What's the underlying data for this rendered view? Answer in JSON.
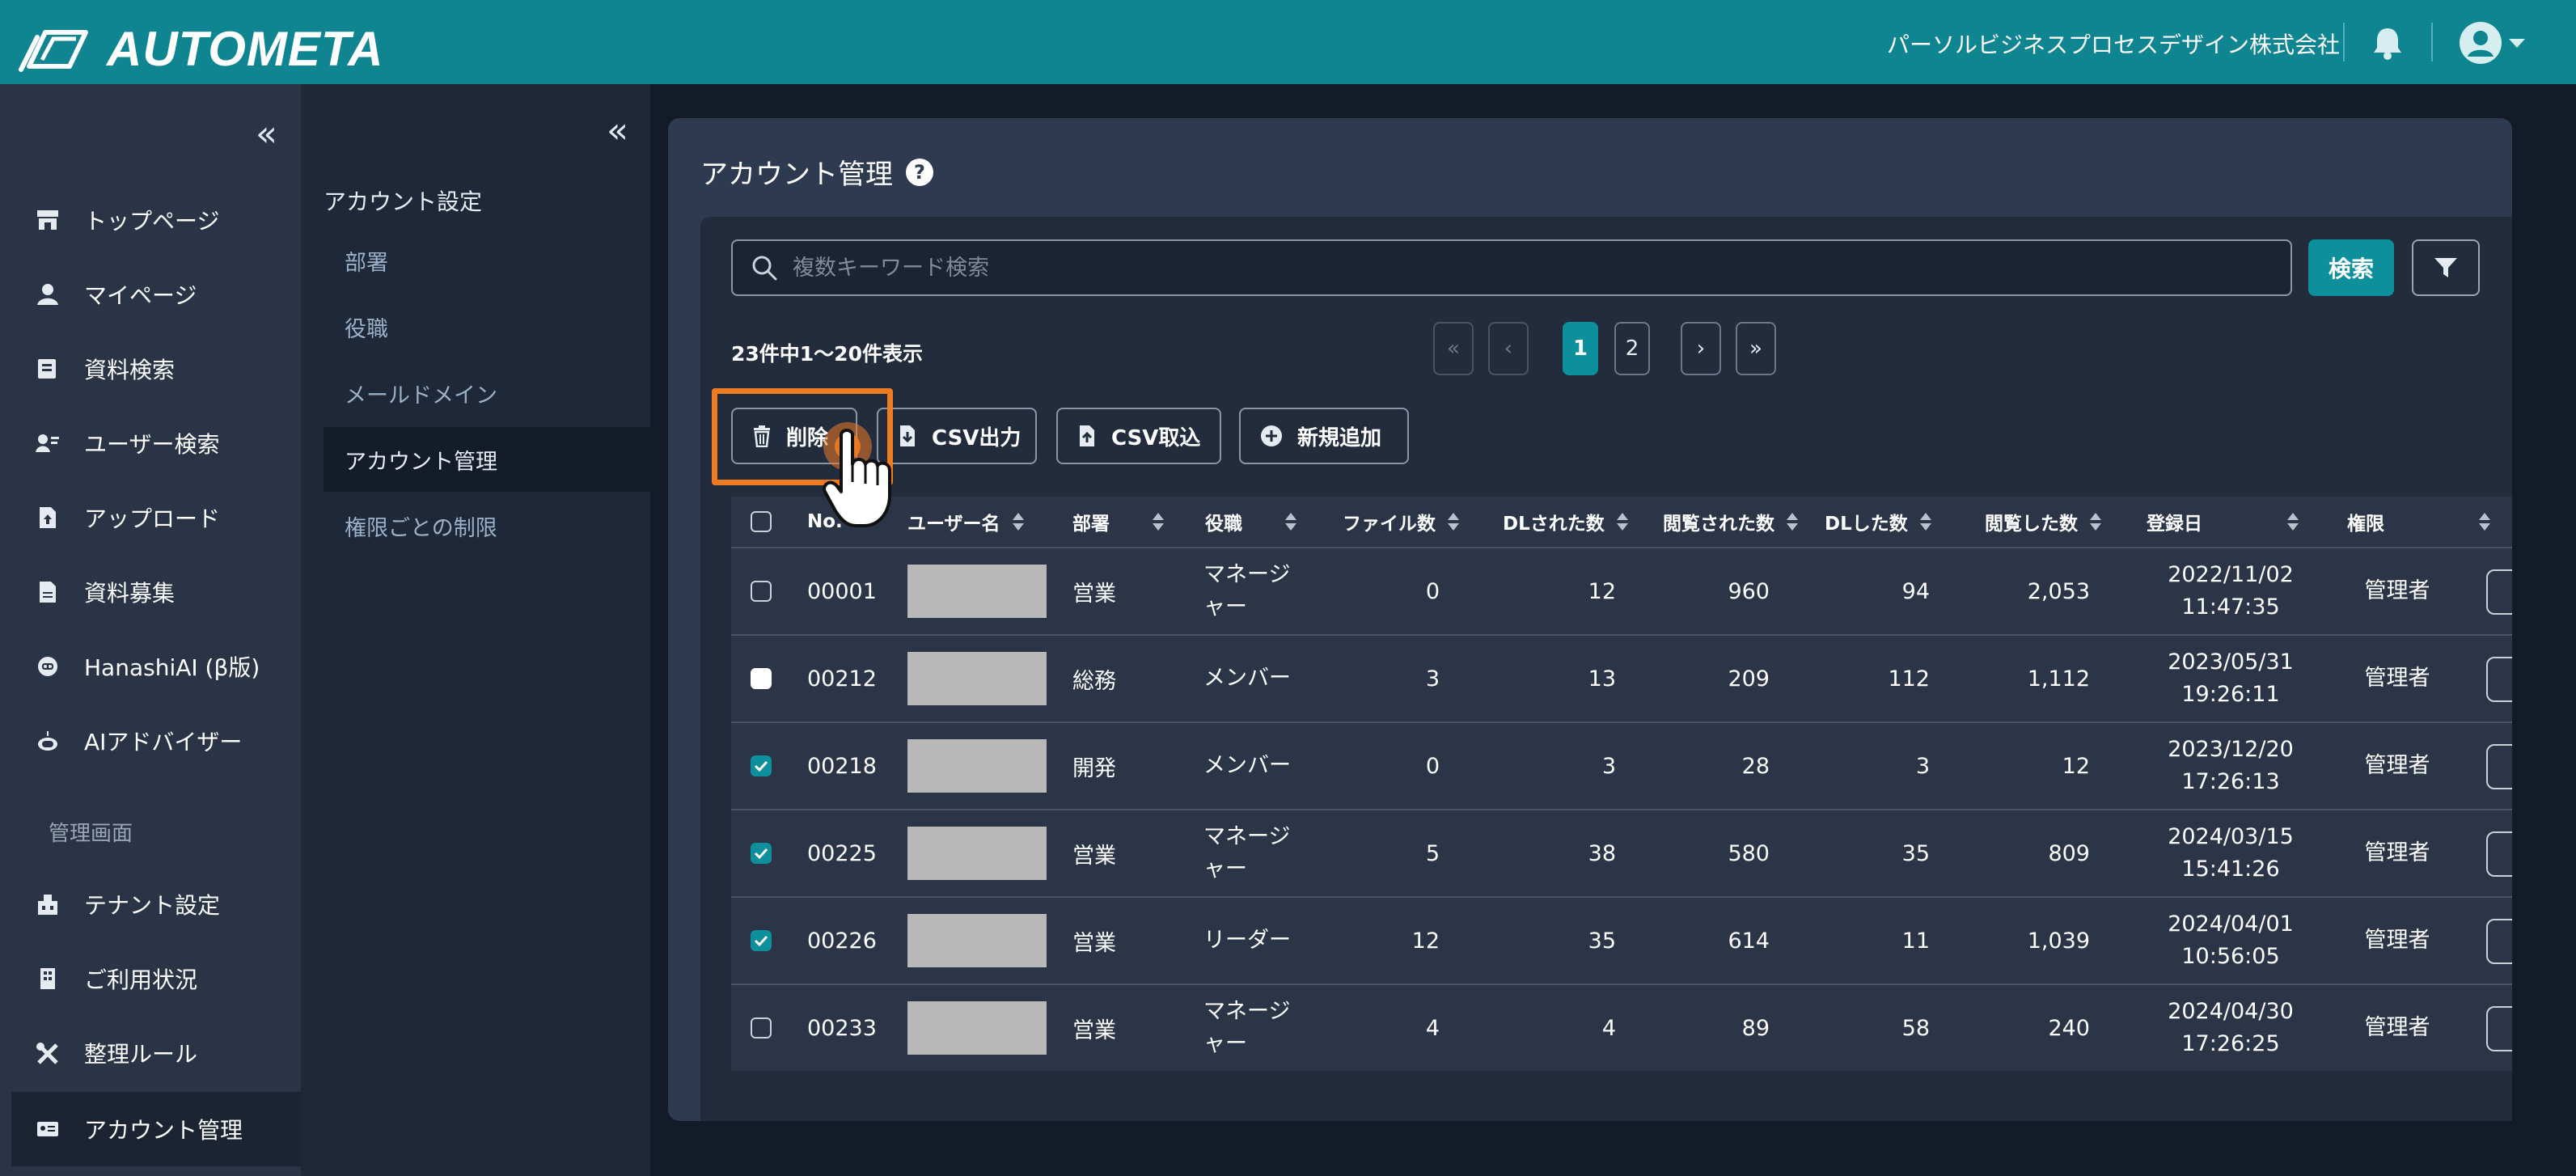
{
  "header": {
    "brand": "AUTOMETA",
    "company": "パーソルビジネスプロセスデザイン株式会社",
    "icons": [
      "logo-icon",
      "bell-icon",
      "user-avatar-icon",
      "caret-down-icon"
    ]
  },
  "sidebar": {
    "collapse": "«",
    "items": [
      {
        "label": "トップページ",
        "icon": "shop-icon"
      },
      {
        "label": "マイページ",
        "icon": "person-icon"
      },
      {
        "label": "資料検索",
        "icon": "documents-icon"
      },
      {
        "label": "ユーザー検索",
        "icon": "user-search-icon"
      },
      {
        "label": "アップロード",
        "icon": "file-upload-icon"
      },
      {
        "label": "資料募集",
        "icon": "file-icon"
      },
      {
        "label": "HanashiAI (β版)",
        "icon": "chat-robot-icon"
      },
      {
        "label": "AIアドバイザー",
        "icon": "robot-icon"
      }
    ],
    "section_label": "管理画面",
    "admin_items": [
      {
        "label": "テナント設定",
        "icon": "building-settings-icon"
      },
      {
        "label": "ご利用状況",
        "icon": "building-icon"
      },
      {
        "label": "整理ルール",
        "icon": "tools-icon"
      },
      {
        "label": "アカウント管理",
        "icon": "id-card-icon"
      }
    ]
  },
  "subnav": {
    "collapse": "«",
    "title": "アカウント設定",
    "items": [
      "部署",
      "役職",
      "メールドメイン",
      "アカウント管理",
      "権限ごとの制限"
    ],
    "active": "アカウント管理"
  },
  "main": {
    "title": "アカウント管理",
    "help": "?",
    "search": {
      "placeholder": "複数キーワード検索",
      "value": "",
      "button": "検索"
    },
    "count_text": "23件中1〜20件表示",
    "pagination": {
      "first": "«",
      "prev": "‹",
      "pages": [
        "1",
        "2"
      ],
      "current": "1",
      "next": "›",
      "last": "»"
    },
    "actions": {
      "delete": "削除",
      "csv_export": "CSV出力",
      "csv_import": "CSV取込",
      "add_new": "新規追加"
    }
  },
  "table": {
    "columns": [
      "No.",
      "ユーザー名",
      "部署",
      "役職",
      "ファイル数",
      "DLされた数",
      "閲覧された数",
      "DLした数",
      "閲覧した数",
      "登録日",
      "権限"
    ],
    "rows": [
      {
        "checked": "unchecked",
        "no": "00001",
        "dept": "営業",
        "role": "マネージャー",
        "role_l1": "マネージ",
        "role_l2": "ャー",
        "files": "0",
        "dl_by": "12",
        "viewed_by": "960",
        "dl": "94",
        "viewed": "2,053",
        "date": "2022/11/02",
        "time": "11:47:35",
        "perm": "管理者"
      },
      {
        "checked": "filled",
        "no": "00212",
        "dept": "総務",
        "role": "メンバー",
        "role_l1": "メンバー",
        "role_l2": "",
        "files": "3",
        "dl_by": "13",
        "viewed_by": "209",
        "dl": "112",
        "viewed": "1,112",
        "date": "2023/05/31",
        "time": "19:26:11",
        "perm": "管理者"
      },
      {
        "checked": "checked",
        "no": "00218",
        "dept": "開発",
        "role": "メンバー",
        "role_l1": "メンバー",
        "role_l2": "",
        "files": "0",
        "dl_by": "3",
        "viewed_by": "28",
        "dl": "3",
        "viewed": "12",
        "date": "2023/12/20",
        "time": "17:26:13",
        "perm": "管理者"
      },
      {
        "checked": "checked",
        "no": "00225",
        "dept": "営業",
        "role": "マネージャー",
        "role_l1": "マネージ",
        "role_l2": "ャー",
        "files": "5",
        "dl_by": "38",
        "viewed_by": "580",
        "dl": "35",
        "viewed": "809",
        "date": "2024/03/15",
        "time": "15:41:26",
        "perm": "管理者"
      },
      {
        "checked": "checked",
        "no": "00226",
        "dept": "営業",
        "role": "リーダー",
        "role_l1": "リーダー",
        "role_l2": "",
        "files": "12",
        "dl_by": "35",
        "viewed_by": "614",
        "dl": "11",
        "viewed": "1,039",
        "date": "2024/04/01",
        "time": "10:56:05",
        "perm": "管理者"
      },
      {
        "checked": "unchecked",
        "no": "00233",
        "dept": "営業",
        "role": "マネージャー",
        "role_l1": "マネージ",
        "role_l2": "ャー",
        "files": "4",
        "dl_by": "4",
        "viewed_by": "89",
        "dl": "58",
        "viewed": "240",
        "date": "2024/04/30",
        "time": "17:26:25",
        "perm": "管理者"
      }
    ]
  },
  "colors": {
    "teal": "#0e8591",
    "accent": "#0e8f9c",
    "highlight": "#ef7b22"
  }
}
